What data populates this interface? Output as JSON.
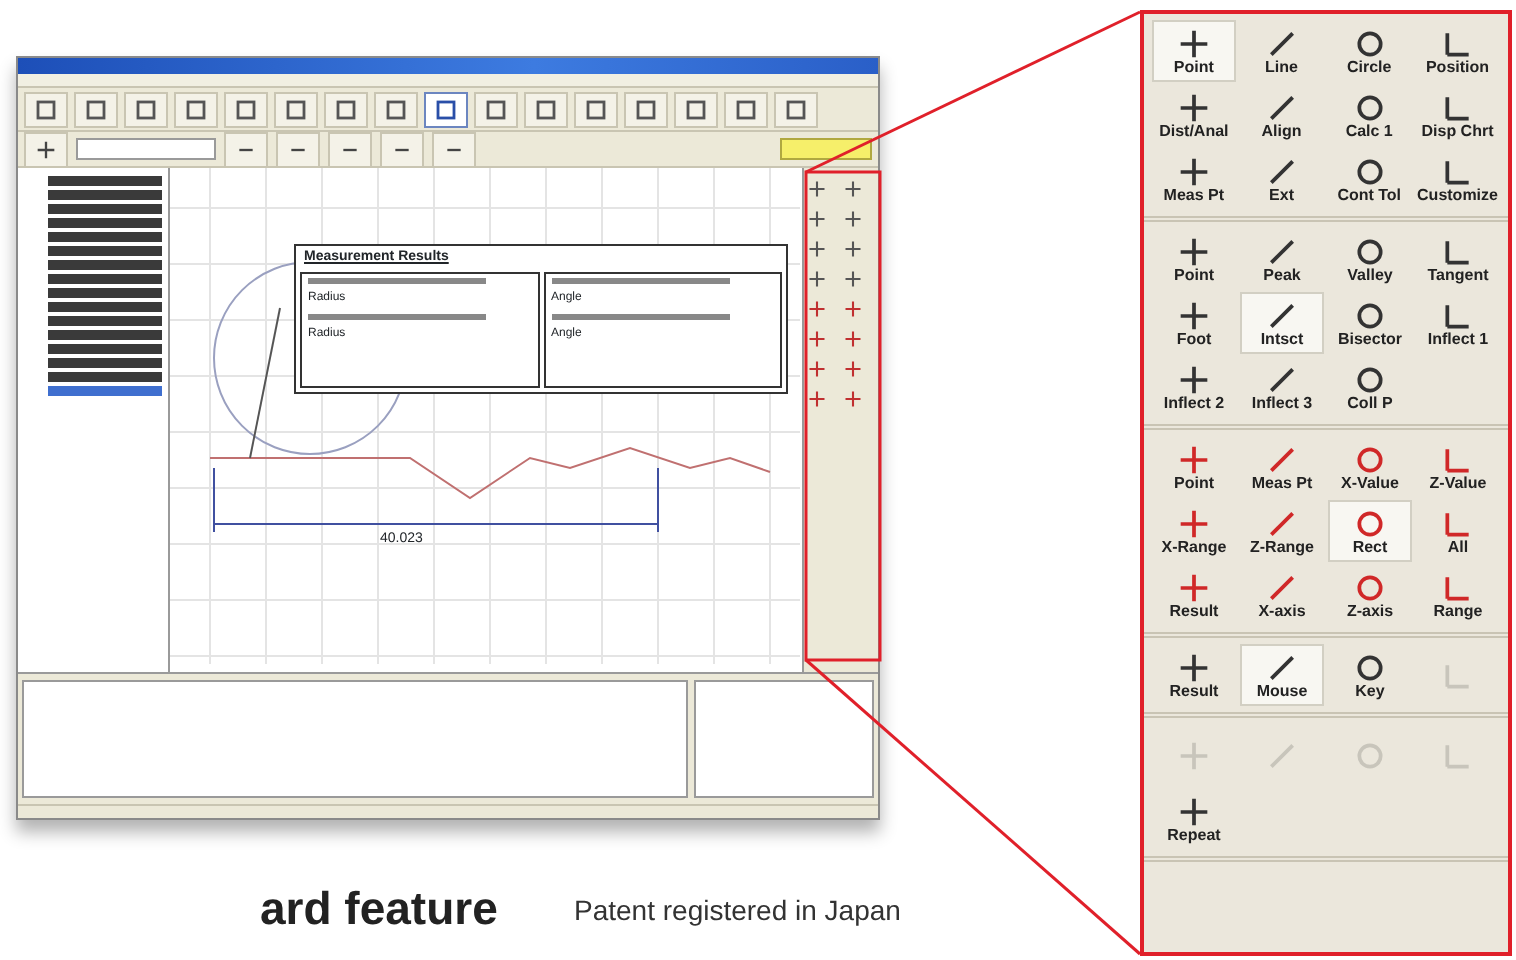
{
  "app_window": {
    "toolbar_1": [
      {
        "selected": false
      },
      {
        "selected": false
      },
      {
        "selected": false
      },
      {
        "selected": false
      },
      {
        "selected": false
      },
      {
        "selected": false
      },
      {
        "selected": false
      },
      {
        "selected": false
      },
      {
        "selected": true
      },
      {
        "selected": false
      },
      {
        "selected": false
      },
      {
        "selected": false
      },
      {
        "selected": false
      },
      {
        "selected": false
      },
      {
        "selected": false
      },
      {
        "selected": false
      }
    ],
    "tree": {
      "items": [
        {
          "selected": false
        },
        {
          "selected": false
        },
        {
          "selected": false
        },
        {
          "selected": false
        },
        {
          "selected": false
        },
        {
          "selected": false
        },
        {
          "selected": false
        },
        {
          "selected": false
        },
        {
          "selected": false
        },
        {
          "selected": false
        },
        {
          "selected": false
        },
        {
          "selected": false
        },
        {
          "selected": false
        },
        {
          "selected": false
        },
        {
          "selected": false
        },
        {
          "selected": true
        }
      ]
    },
    "results": {
      "title": "Measurement Results",
      "left_rows": [
        {
          "label": "Radius"
        },
        {
          "label": "Radius"
        }
      ],
      "right_rows": [
        {
          "label": "Angle"
        },
        {
          "label": "Angle"
        }
      ]
    },
    "dimension_label": "40.023"
  },
  "palette": {
    "sections": [
      {
        "items": [
          {
            "label": "Point",
            "selected": true,
            "disabled": false
          },
          {
            "label": "Line",
            "selected": false,
            "disabled": false
          },
          {
            "label": "Circle",
            "selected": false,
            "disabled": false
          },
          {
            "label": "Position",
            "selected": false,
            "disabled": false
          },
          {
            "label": "Dist/Anal",
            "selected": false,
            "disabled": false
          },
          {
            "label": "Align",
            "selected": false,
            "disabled": false
          },
          {
            "label": "Calc 1",
            "selected": false,
            "disabled": false
          },
          {
            "label": "Disp Chrt",
            "selected": false,
            "disabled": false
          },
          {
            "label": "Meas Pt",
            "selected": false,
            "disabled": false
          },
          {
            "label": "Ext",
            "selected": false,
            "disabled": false
          },
          {
            "label": "Cont Tol",
            "selected": false,
            "disabled": false
          },
          {
            "label": "Customize",
            "selected": false,
            "disabled": false
          }
        ]
      },
      {
        "items": [
          {
            "label": "Point",
            "selected": false,
            "disabled": false
          },
          {
            "label": "Peak",
            "selected": false,
            "disabled": false
          },
          {
            "label": "Valley",
            "selected": false,
            "disabled": false
          },
          {
            "label": "Tangent",
            "selected": false,
            "disabled": false
          },
          {
            "label": "Foot",
            "selected": false,
            "disabled": false
          },
          {
            "label": "Intsct",
            "selected": true,
            "disabled": false
          },
          {
            "label": "Bisector",
            "selected": false,
            "disabled": false
          },
          {
            "label": "Inflect 1",
            "selected": false,
            "disabled": false
          },
          {
            "label": "Inflect 2",
            "selected": false,
            "disabled": false
          },
          {
            "label": "Inflect 3",
            "selected": false,
            "disabled": false
          },
          {
            "label": "Coll P",
            "selected": false,
            "disabled": false
          }
        ]
      },
      {
        "items": [
          {
            "label": "Point",
            "selected": false,
            "disabled": false
          },
          {
            "label": "Meas Pt",
            "selected": false,
            "disabled": false
          },
          {
            "label": "X-Value",
            "selected": false,
            "disabled": false
          },
          {
            "label": "Z-Value",
            "selected": false,
            "disabled": false
          },
          {
            "label": "X-Range",
            "selected": false,
            "disabled": false
          },
          {
            "label": "Z-Range",
            "selected": false,
            "disabled": false
          },
          {
            "label": "Rect",
            "selected": true,
            "disabled": false
          },
          {
            "label": "All",
            "selected": false,
            "disabled": false
          },
          {
            "label": "Result",
            "selected": false,
            "disabled": false
          },
          {
            "label": "X-axis",
            "selected": false,
            "disabled": false
          },
          {
            "label": "Z-axis",
            "selected": false,
            "disabled": false
          },
          {
            "label": "Range",
            "selected": false,
            "disabled": false
          }
        ]
      },
      {
        "items": [
          {
            "label": "Result",
            "selected": false,
            "disabled": false
          },
          {
            "label": "Mouse",
            "selected": true,
            "disabled": false
          },
          {
            "label": "Key",
            "selected": false,
            "disabled": false
          },
          {
            "selected": false,
            "disabled": true
          }
        ]
      },
      {
        "items": [
          {
            "selected": false,
            "disabled": true
          },
          {
            "selected": false,
            "disabled": true
          },
          {
            "selected": false,
            "disabled": true
          },
          {
            "selected": false,
            "disabled": true
          },
          {
            "label": "Repeat",
            "selected": false,
            "disabled": false
          }
        ]
      }
    ]
  },
  "headline": "ard feature",
  "note": "Patent registered in Japan"
}
